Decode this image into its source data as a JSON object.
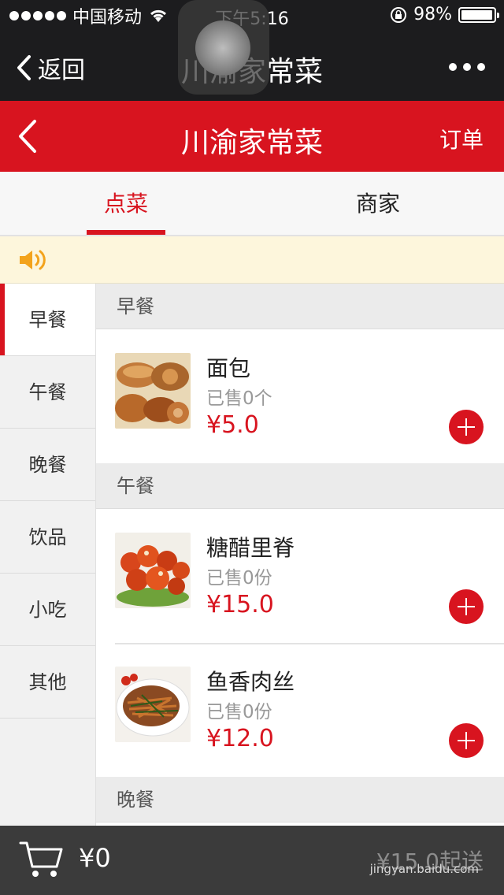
{
  "status_bar": {
    "carrier": "中国移动",
    "time": "下午5:16",
    "battery": "98%",
    "battery_level": 0.98
  },
  "wechat_nav": {
    "back_label": "返回",
    "title": "川渝家常菜",
    "more_icon": "ellipsis-icon"
  },
  "header": {
    "title": "川渝家常菜",
    "order_label": "订单",
    "back_icon": "chevron-left-icon"
  },
  "tabs": [
    {
      "label": "点菜",
      "active": true
    },
    {
      "label": "商家",
      "active": false
    }
  ],
  "notice": {
    "icon": "speaker-icon",
    "text": ""
  },
  "sidebar": {
    "items": [
      {
        "label": "早餐",
        "active": true
      },
      {
        "label": "午餐",
        "active": false
      },
      {
        "label": "晚餐",
        "active": false
      },
      {
        "label": "饮品",
        "active": false
      },
      {
        "label": "小吃",
        "active": false
      },
      {
        "label": "其他",
        "active": false
      }
    ]
  },
  "menu": {
    "sections": [
      {
        "title": "早餐",
        "items": [
          {
            "name": "面包",
            "sold": "已售0个",
            "price": "¥5.0",
            "image": "bread"
          }
        ]
      },
      {
        "title": "午餐",
        "items": [
          {
            "name": "糖醋里脊",
            "sold": "已售0份",
            "price": "¥15.0",
            "image": "sweet-sour-pork"
          },
          {
            "name": "鱼香肉丝",
            "sold": "已售0份",
            "price": "¥12.0",
            "image": "fish-flavored-pork"
          }
        ]
      },
      {
        "title": "晚餐",
        "items": []
      }
    ]
  },
  "bottom_bar": {
    "cart_icon": "shopping-cart-icon",
    "total": "¥0",
    "min_delivery": "¥15.0起送"
  },
  "watermark": "jingyan.baidu.com",
  "colors": {
    "brand_red": "#d8141f",
    "dark_bar": "#1c1c1e",
    "bottom_bar": "#3b3b3b"
  }
}
